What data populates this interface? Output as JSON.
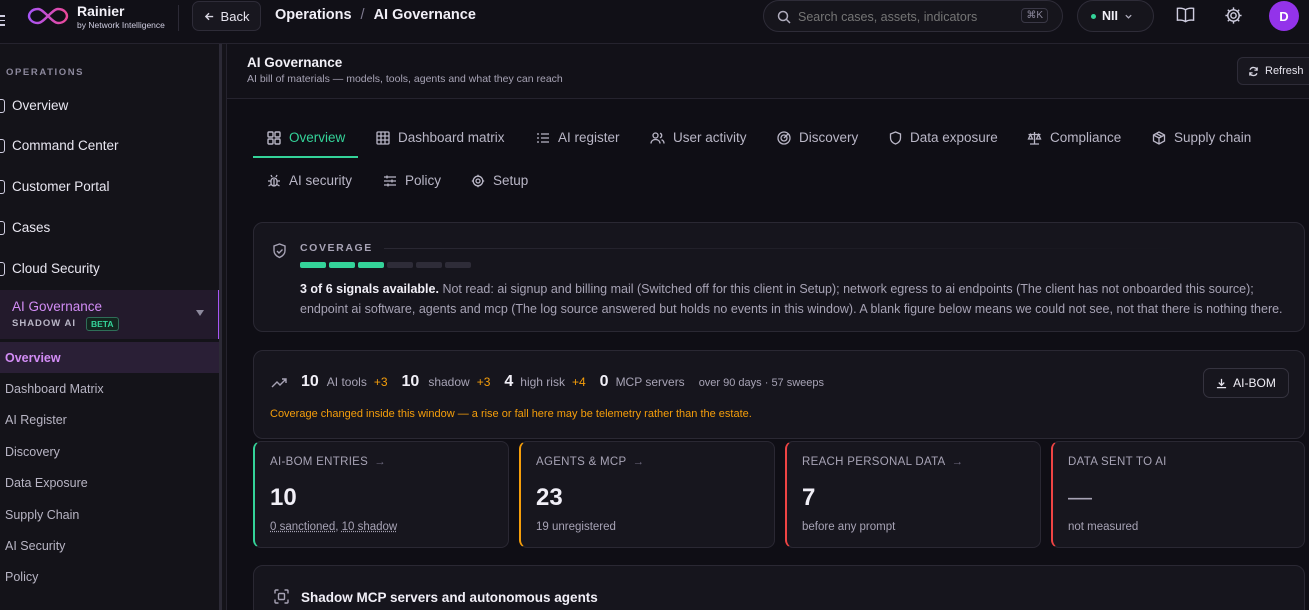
{
  "brand": {
    "name": "Rainier",
    "tagline": "by Network Intelligence"
  },
  "topbar": {
    "back_label": "Back",
    "breadcrumb": [
      "Operations",
      "AI Governance"
    ],
    "breadcrumb_sep": "/",
    "search_placeholder": "Search cases, assets, indicators",
    "search_shortcut": "⌘K",
    "tenant": "NII",
    "avatar_initial": "D"
  },
  "sidebar": {
    "section": "OPERATIONS",
    "items": [
      "Overview",
      "Command Center",
      "Customer Portal",
      "Cases",
      "Cloud Security"
    ],
    "active": {
      "label": "AI Governance",
      "sub": "SHADOW AI",
      "badge": "BETA"
    },
    "subitems": [
      "Overview",
      "Dashboard Matrix",
      "AI Register",
      "Discovery",
      "Data Exposure",
      "Supply Chain",
      "AI Security",
      "Policy"
    ]
  },
  "page": {
    "title": "AI Governance",
    "subtitle": "AI bill of materials — models, tools, agents and what they can reach",
    "refresh_label": "Refresh"
  },
  "tabs": [
    "Overview",
    "Dashboard matrix",
    "AI register",
    "User activity",
    "Discovery",
    "Data exposure",
    "Compliance",
    "Supply chain",
    "AI security",
    "Policy",
    "Setup"
  ],
  "coverage": {
    "label": "COVERAGE",
    "signals_read": 3,
    "signals_total": 6,
    "headline": "3 of 6 signals available.",
    "detail_line1": "Not read: ai signup and billing mail (Switched off for this client in Setup); network egress to ai endpoints (The client has not onboarded this source);",
    "detail_line2": "endpoint ai software, agents and mcp (The log source answered but holds no events in this window). A blank figure below means we could not see, not that there is nothing there."
  },
  "summary": {
    "ai_tools": "10",
    "ai_tools_label": "AI tools",
    "ai_tools_delta": "+3",
    "shadow": "10",
    "shadow_label": "shadow",
    "shadow_delta": "+3",
    "high_risk": "4",
    "high_risk_label": "high risk",
    "high_risk_delta": "+4",
    "mcp": "0",
    "mcp_label": "MCP servers",
    "window": "over 90 days · 57 sweeps",
    "warning": "Coverage changed inside this window — a rise or fall here may be telemetry rather than the estate.",
    "aibom_button": "AI-BOM"
  },
  "stats": [
    {
      "label": "AI-BOM ENTRIES",
      "value": "10",
      "sub_a": "0 sanctioned",
      "sub_sep": ", ",
      "sub_b": "10 shadow",
      "color": "#34d399"
    },
    {
      "label": "AGENTS & MCP",
      "value": "23",
      "sub": "19 unregistered",
      "color": "#f59e0b"
    },
    {
      "label": "REACH PERSONAL DATA",
      "value": "7",
      "sub": "before any prompt",
      "color": "#ef4444"
    },
    {
      "label": "DATA SENT TO AI",
      "value": "—",
      "sub": "not measured",
      "color": "#ef4444"
    }
  ],
  "shadow_section": {
    "title": "Shadow MCP servers and autonomous agents"
  },
  "colors": {
    "accent": "#34d399",
    "brand": "#c026d3",
    "warning": "#f59e0b",
    "danger": "#ef4444",
    "active_bg": "#2a1f36"
  }
}
